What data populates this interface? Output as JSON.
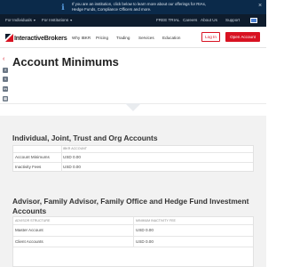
{
  "banner": {
    "text": "If you are an institution, click below to learn more about our offerings for RIAs, Hedge Funds, Compliance Officers and more.",
    "close_label": "×",
    "colors": {
      "background": "#0b2a4a",
      "icon": "#5aa0e6"
    },
    "icon": "info-icon"
  },
  "utility_bar": {
    "audience_dropdown": "For Individuals",
    "institutions_dropdown": "For Institutions",
    "links": [
      "FREE TRIAL",
      "Careers",
      "About Us",
      "Support"
    ],
    "colors": {
      "background": "#0e1c2d"
    }
  },
  "navbar": {
    "logo_text": "InteractiveBrokers",
    "links": [
      "Why IBKR",
      "Pricing",
      "Trading",
      "Services",
      "Education"
    ],
    "login_label": "Log In",
    "open_account_label": "Open Account",
    "colors": {
      "accent": "#d81222"
    }
  },
  "page": {
    "title": "Account Minimums",
    "back_icon": "chevron-left-icon",
    "side_icons": [
      "facebook-icon",
      "twitter-icon",
      "linkedin-icon",
      "print-icon"
    ]
  },
  "section1": {
    "title": "Individual, Joint, Trust and Org Accounts",
    "table": {
      "header": [
        "",
        "IBKR ACCOUNT"
      ],
      "rows": [
        [
          "Account Minimums",
          "USD 0.00"
        ],
        [
          "Inactivity Fees",
          "USD 0.00"
        ]
      ]
    }
  },
  "section2": {
    "title": "Advisor, Family Advisor, Family Office and Hedge Fund Investment Accounts",
    "table": {
      "header": [
        "ADVISOR STRUCTURE",
        "MINIMUM INACTIVITY FEE"
      ],
      "rows": [
        [
          "Master Account",
          "USD 0.00"
        ],
        [
          "Client Accounts",
          "USD 0.00"
        ]
      ]
    }
  }
}
